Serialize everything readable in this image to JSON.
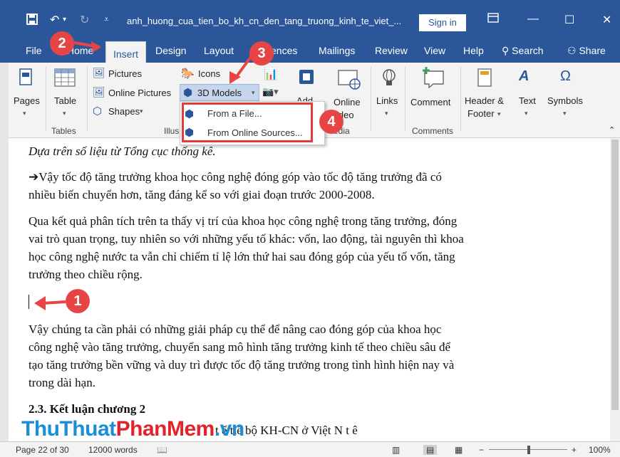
{
  "titlebar": {
    "filename": "anh_huong_cua_tien_bo_kh_cn_den_tang_truong_kinh_te_viet_...",
    "signin": "Sign in"
  },
  "tabs": [
    "File",
    "Home",
    "Insert",
    "Design",
    "Layout",
    "References",
    "Mailings",
    "Review",
    "View",
    "Help"
  ],
  "tabs_visible": {
    "file": "File",
    "home": "Home",
    "insert": "Insert",
    "design": "Design",
    "layout": "Layout",
    "references": "ences",
    "mailings": "Mailings",
    "review": "Review",
    "view": "View",
    "help": "Help"
  },
  "search": "Search",
  "share": "Share",
  "ribbon": {
    "pages": "Pages",
    "table": "Table",
    "tables_group": "Tables",
    "pictures": "Pictures",
    "online_pictures": "Online Pictures",
    "shapes": "Shapes",
    "icons": "Icons",
    "models_3d": "3D Models",
    "illus_group": "Illus",
    "addins": "Add-",
    "online_video_1": "Online",
    "online_video_2": "ideo",
    "media_group": "edia",
    "links": "Links",
    "comment": "Comment",
    "comments_group": "Comments",
    "header_footer_1": "Header &",
    "header_footer_2": "Footer",
    "text": "Text",
    "symbols": "Symbols"
  },
  "dropdown": {
    "from_file": "From a File...",
    "from_online": "From Online Sources..."
  },
  "document": {
    "p1": "Dựa trên số liệu từ Tổng cục thống kê.",
    "p2a": "➔Vậy tốc độ tăng trưởng khoa học công nghệ đóng góp vào tốc độ tăng trưởng đã có",
    "p2b": "nhiều biến chuyển hơn, tăng đáng kể so với giai đoạn trước 2000-2008.",
    "p3a": "Qua kết quả phân tích trên ta thấy vị trí của khoa học công nghệ trong tăng trưởng, đóng",
    "p3b": "vai trò quan trọng, tuy nhiên so với những yếu tố khác: vốn, lao động, tài nguyên thì khoa",
    "p3c": "học công nghệ nước ta vẫn chỉ chiếm tỉ lệ lớn thứ hai sau đóng góp của yếu tố vốn, tăng",
    "p3d": "trưởng theo chiều rộng.",
    "p4a": " Vậy chúng ta cần phải có những giải pháp cụ thể để nâng cao đóng góp của khoa học",
    "p4b": "công nghệ vào tăng trưởng, chuyển sang mô hình tăng trưởng kinh tế theo chiều sâu để",
    "p4c": "tạo tăng trưởng bền vững và duy trì được tốc độ tăng trưởng trong tình hình hiện nay và",
    "p4d": "trong dài hạn.",
    "h1": "2.3.  Kết luận chương 2",
    "p5_partial": "t              ể   tiế  bộ KH-CN ở Việt N    t      ê"
  },
  "status": {
    "page": "Page 22 of 30",
    "words": "12000 words",
    "zoom": "100%"
  },
  "badges": {
    "b1": "1",
    "b2": "2",
    "b3": "3",
    "b4": "4"
  },
  "watermark": {
    "part1": "ThuThuat",
    "part2": "PhanMem",
    "part3": ".vn"
  },
  "colors": {
    "word_blue": "#2b579a",
    "badge_red": "#e74545",
    "watermark_blue": "#1b8fd6",
    "watermark_red": "#e3232b"
  }
}
